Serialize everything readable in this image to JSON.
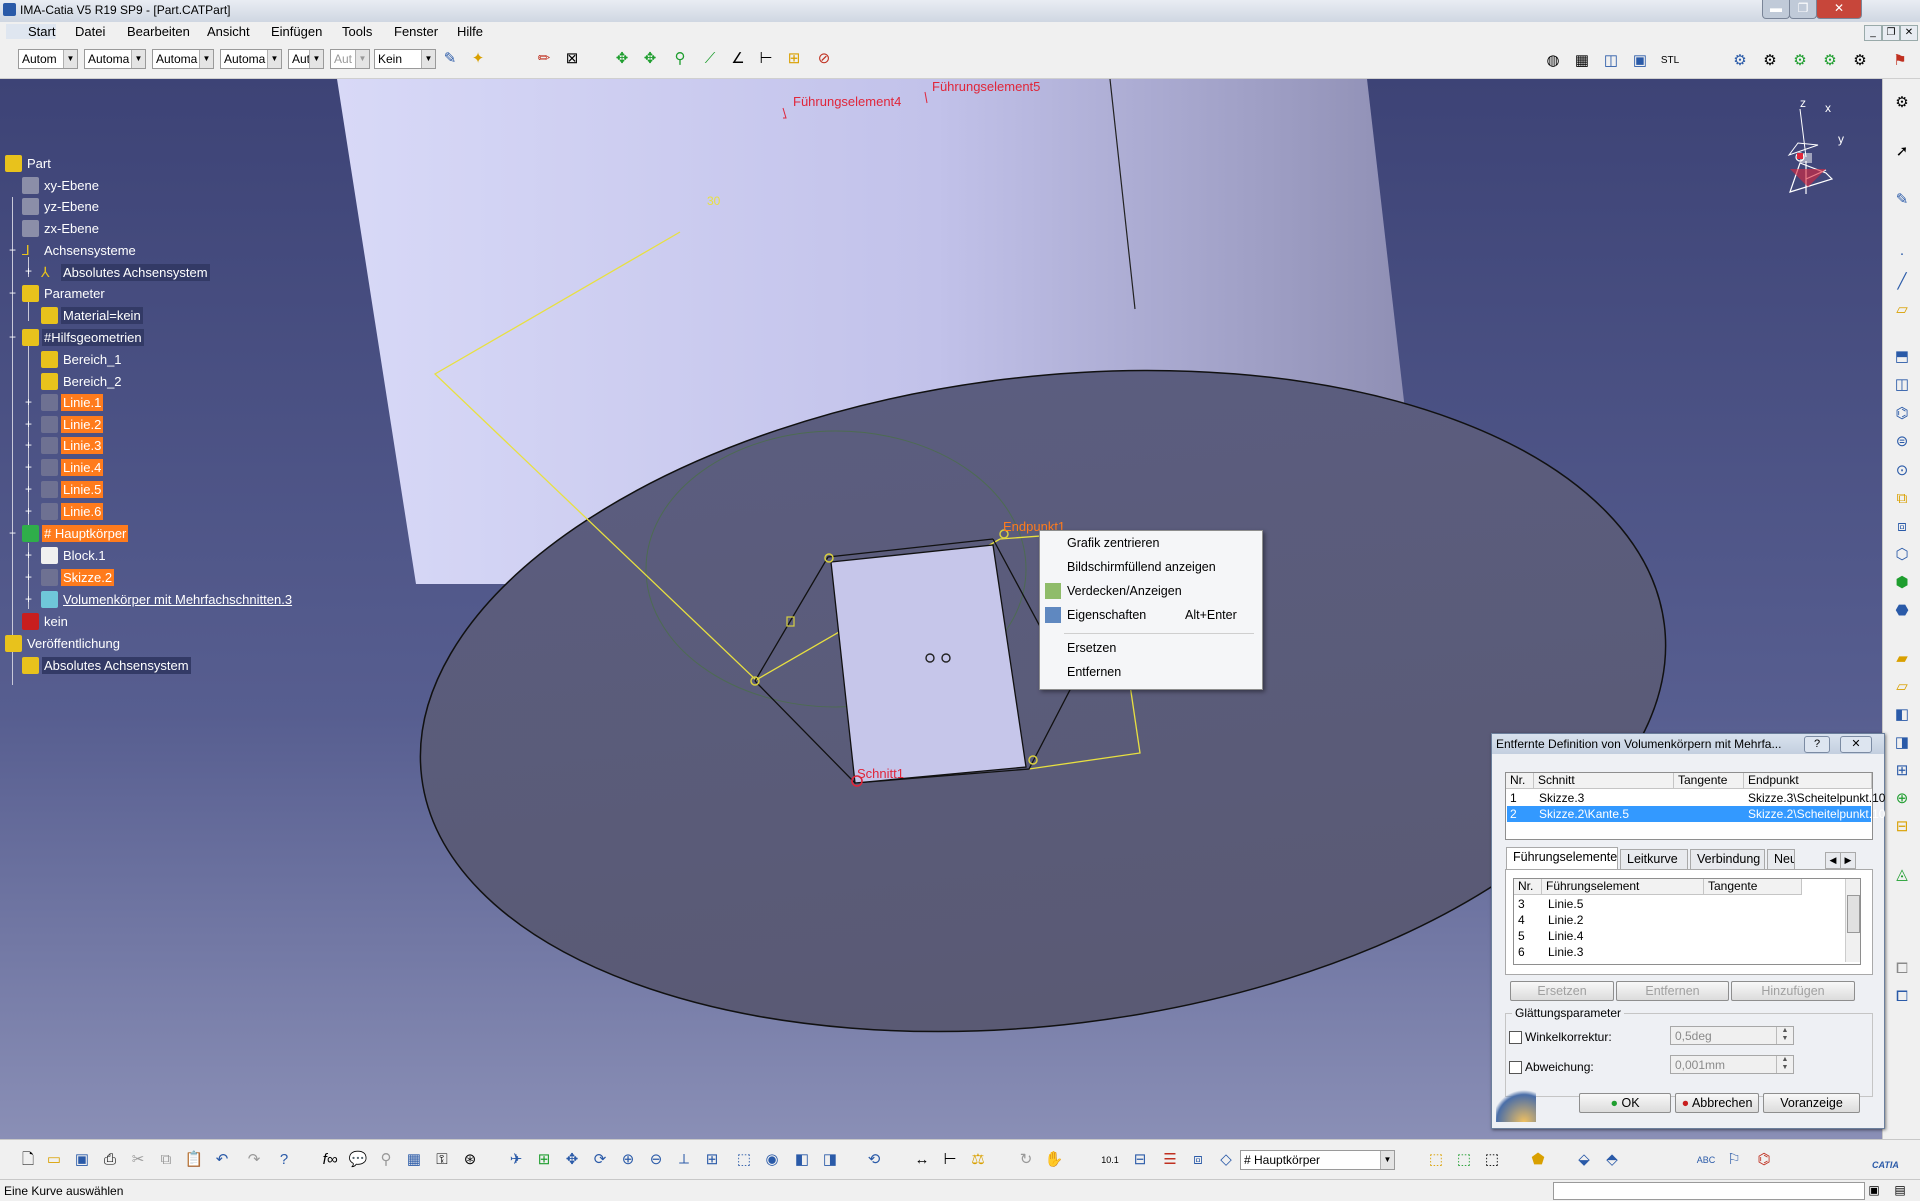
{
  "window": {
    "title": "IMA-Catia V5 R19 SP9 - [Part.CATPart]"
  },
  "menu": [
    "Start",
    "Datei",
    "Bearbeiten",
    "Ansicht",
    "Einfügen",
    "Tools",
    "Fenster",
    "Hilfe"
  ],
  "toolbar": {
    "combos": [
      "Autom",
      "Automa",
      "Automa",
      "Automa",
      "Aut",
      "Aut",
      "Kein"
    ]
  },
  "tree": {
    "nodes": [
      {
        "label": "Part"
      },
      {
        "label": "xy-Ebene"
      },
      {
        "label": "yz-Ebene"
      },
      {
        "label": "zx-Ebene"
      },
      {
        "label": "Achsensysteme"
      },
      {
        "label": "Absolutes Achsensystem"
      },
      {
        "label": "Parameter"
      },
      {
        "label": "Material=kein"
      },
      {
        "label": "#Hilfsgeometrien"
      },
      {
        "label": "Bereich_1"
      },
      {
        "label": "Bereich_2"
      },
      {
        "label": "Linie.1"
      },
      {
        "label": "Linie.2"
      },
      {
        "label": "Linie.3"
      },
      {
        "label": "Linie.4"
      },
      {
        "label": "Linie.5"
      },
      {
        "label": "Linie.6"
      },
      {
        "label": "# Hauptkörper"
      },
      {
        "label": "Block.1"
      },
      {
        "label": "Skizze.2"
      },
      {
        "label": "Volumenkörper mit Mehrfachschnitten.3"
      },
      {
        "label": "kein"
      },
      {
        "label": "Veröffentlichung"
      },
      {
        "label": "Absolutes Achsensystem"
      }
    ]
  },
  "viewport": {
    "labels": {
      "guide4": "Führungselement4",
      "guide5": "Führungselement5",
      "endpoint": "Endpunkt1",
      "section": "Schnitt1",
      "dim": "30"
    },
    "compass": {
      "x": "x",
      "y": "y",
      "z": "z"
    }
  },
  "context_menu": {
    "items": [
      "Grafik zentrieren",
      "Bildschirmfüllend anzeigen",
      "Verdecken/Anzeigen",
      "Eigenschaften",
      "Ersetzen",
      "Entfernen"
    ],
    "shortcut": "Alt+Enter"
  },
  "dialog": {
    "title": "Entfernte Definition von Volumenkörpern mit Mehrfa...",
    "help": "?",
    "close": "✕",
    "sections_headers": [
      "Nr.",
      "Schnitt",
      "Tangente",
      "Endpunkt"
    ],
    "sections_rows": [
      [
        "1",
        "Skizze.3",
        "",
        "Skizze.3\\Scheitelpunkt.10"
      ],
      [
        "2",
        "Skizze.2\\Kante.5",
        "",
        "Skizze.2\\Scheitelpunkt.10"
      ]
    ],
    "tabs": [
      "Führungselemente",
      "Leitkurve",
      "Verbindung",
      "Neu"
    ],
    "guides_headers": [
      "Nr.",
      "Führungselement",
      "Tangente"
    ],
    "guides_rows": [
      [
        "3",
        "Linie.5"
      ],
      [
        "4",
        "Linie.2"
      ],
      [
        "5",
        "Linie.4"
      ],
      [
        "6",
        "Linie.3"
      ]
    ],
    "actions": [
      "Ersetzen",
      "Entfernen",
      "Hinzufügen"
    ],
    "smoothing": {
      "group": "Glättungsparameter",
      "angle_label": "Winkelkorrektur:",
      "angle_value": "0,5deg",
      "dev_label": "Abweichung:",
      "dev_value": "0,001mm"
    },
    "buttons": {
      "ok": "OK",
      "cancel": "Abbrechen",
      "preview": "Voranzeige"
    }
  },
  "bottom": {
    "body_combo": "# Hauptkörper",
    "status": "Eine Kurve auswählen",
    "logo": "CATIA"
  },
  "colors": {
    "highlight": "#ff7b1c",
    "annotation": "#e0263a",
    "sketch": "#e8e040",
    "selection": "#3399ff"
  }
}
